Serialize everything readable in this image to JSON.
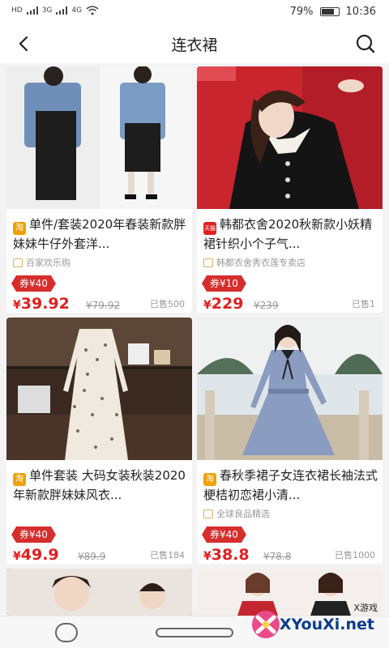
{
  "status": {
    "left_labels": [
      "HD",
      "3G",
      "4G"
    ],
    "battery": "79%",
    "battery_level": 0.79,
    "time": "10:36"
  },
  "nav": {
    "title": "连衣裙",
    "back_icon": "chevron-left-icon",
    "search_icon": "search-icon"
  },
  "products": [
    {
      "badge": "淘",
      "title": "单件/套装2020年春装新款胖妹妹牛仔外套洋...",
      "shop": "百家欢乐购",
      "coupon": "券¥40",
      "currency": "¥",
      "price": "39.92",
      "original": "¥79.92",
      "sold": "已售500"
    },
    {
      "badge": "天猫",
      "title": "韩都衣舍2020秋新款小妖精裙针织小个子气...",
      "shop": "韩都衣舍秀衣莲专卖店",
      "coupon": "券¥10",
      "currency": "¥",
      "price": "229",
      "original": "¥239",
      "sold": "已售1"
    },
    {
      "badge": "淘",
      "title": "单件套装 大码女装秋装2020年新款胖妹妹风衣...",
      "shop": "",
      "coupon": "券¥40",
      "currency": "¥",
      "price": "49.9",
      "original": "¥89.9",
      "sold": "已售184"
    },
    {
      "badge": "淘",
      "title": "春秋季裙子女连衣裙长袖法式梗桔初恋裙小清...",
      "shop": "全球良品精选",
      "coupon": "券¥40",
      "currency": "¥",
      "price": "38.8",
      "original": "¥78.8",
      "sold": "已售1000"
    }
  ],
  "watermark": {
    "tag": "X游戏",
    "text": "XYouXi.net"
  },
  "colors": {
    "accent_red": "#e02020",
    "coupon_red": "#d62d2d",
    "taobao_orange": "#f0a000"
  }
}
